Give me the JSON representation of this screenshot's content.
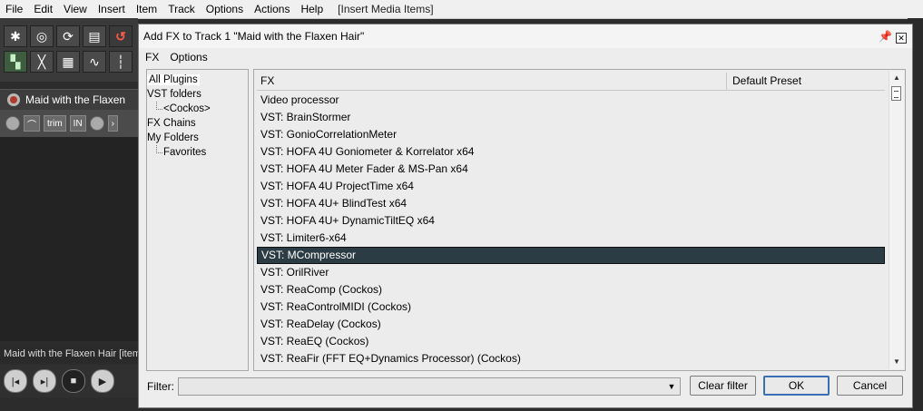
{
  "app_menu": {
    "items": [
      "File",
      "Edit",
      "View",
      "Insert",
      "Item",
      "Track",
      "Options",
      "Actions",
      "Help"
    ],
    "status": "[Insert Media Items]"
  },
  "track": {
    "name": "Maid with the Flaxen",
    "trim_label": "trim",
    "in_label": "IN",
    "status_text": "Maid with the Flaxen Hair [item"
  },
  "toolbar": {
    "icons": [
      "new-project-icon",
      "open-project-icon",
      "save-icon",
      "new-track-icon",
      "undo-icon",
      "snap-icon",
      "ripple-icon",
      "grid-icon",
      "envelope-icon",
      "markers-icon"
    ]
  },
  "dialog": {
    "title": "Add FX to Track 1 \"Maid with the Flaxen Hair\"",
    "menu": [
      "FX",
      "Options"
    ],
    "tree": [
      {
        "label": "All Plugins",
        "child": false,
        "selected": true
      },
      {
        "label": "VST folders",
        "child": false,
        "selected": false
      },
      {
        "label": "<Cockos>",
        "child": true,
        "selected": false
      },
      {
        "label": "FX Chains",
        "child": false,
        "selected": false
      },
      {
        "label": "My Folders",
        "child": false,
        "selected": false
      },
      {
        "label": "Favorites",
        "child": true,
        "selected": false
      }
    ],
    "columns": {
      "fx": "FX",
      "preset": "Default Preset"
    },
    "rows": [
      "Video processor",
      "VST: BrainStormer",
      "VST: GonioCorrelationMeter",
      "VST: HOFA 4U Goniometer & Korrelator x64",
      "VST: HOFA 4U Meter Fader & MS-Pan x64",
      "VST: HOFA 4U ProjectTime x64",
      "VST: HOFA 4U+ BlindTest x64",
      "VST: HOFA 4U+ DynamicTiltEQ x64",
      "VST: Limiter6-x64",
      "VST: MCompressor",
      "VST: OrilRiver",
      "VST: ReaComp (Cockos)",
      "VST: ReaControlMIDI (Cockos)",
      "VST: ReaDelay (Cockos)",
      "VST: ReaEQ (Cockos)",
      "VST: ReaFir (FFT EQ+Dynamics Processor) (Cockos)"
    ],
    "selected_row": 9,
    "filter_label": "Filter:",
    "filter_value": "",
    "buttons": {
      "clear_filter": "Clear filter",
      "ok": "OK",
      "cancel": "Cancel"
    }
  }
}
